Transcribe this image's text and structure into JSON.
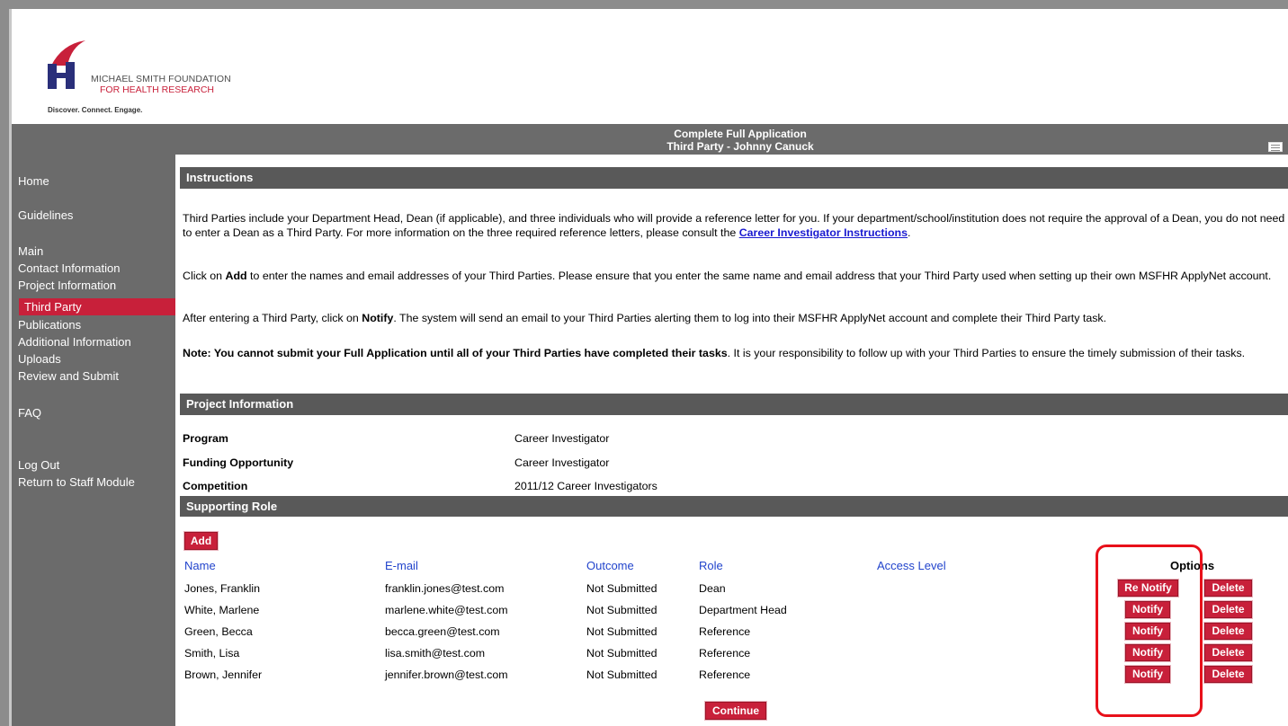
{
  "logo": {
    "line1": "MICHAEL SMITH FOUNDATION",
    "line2": "FOR HEALTH RESEARCH",
    "tagline": "Discover. Connect. Engage."
  },
  "header": {
    "title": "Complete Full Application",
    "subtitle": "Third Party  -  Johnny Canuck"
  },
  "sidebar": {
    "items": [
      {
        "label": "Home"
      },
      {
        "label": "Guidelines"
      },
      {
        "label": "Main"
      },
      {
        "label": "Contact Information"
      },
      {
        "label": "Project Information"
      },
      {
        "label": "Third Party"
      },
      {
        "label": "Publications"
      },
      {
        "label": "Additional Information"
      },
      {
        "label": "Uploads"
      },
      {
        "label": "Review and Submit"
      },
      {
        "label": "FAQ"
      },
      {
        "label": "Log Out"
      },
      {
        "label": "Return to Staff Module"
      }
    ]
  },
  "instructions": {
    "heading": "Instructions",
    "p1_text": "Third Parties include your Department Head, Dean (if applicable), and three individuals who will provide a reference letter for you. If your department/school/institution does not require the approval of a Dean, you do not need to enter a Dean as a Third Party. For more information on the three required reference letters, please consult the ",
    "p1_link": "Career Investigator Instructions",
    "p1_end": ".",
    "p2_pre": "Click on ",
    "p2_bold": "Add",
    "p2_post": " to enter the names and email addresses of your Third Parties. Please ensure that you enter the same name and email address that your Third Party used when setting up their own MSFHR ApplyNet account.",
    "p3_pre": "After entering a Third Party, click on ",
    "p3_bold": "Notify",
    "p3_post": ". The system will send an email to your Third Parties alerting them to log into their MSFHR ApplyNet account and complete their Third Party task.",
    "p4_bold": "Note: You cannot submit your Full Application until all of your Third Parties have completed their tasks",
    "p4_post": ". It is your responsibility to follow up with your Third Parties to ensure the timely submission of their tasks."
  },
  "project": {
    "heading": "Project Information",
    "fields": [
      {
        "label": "Program",
        "value": "Career Investigator"
      },
      {
        "label": "Funding Opportunity",
        "value": "Career Investigator"
      },
      {
        "label": "Competition",
        "value": "2011/12 Career Investigators"
      }
    ]
  },
  "supporting": {
    "heading": "Supporting Role",
    "add_label": "Add",
    "columns": {
      "name": "Name",
      "email": "E-mail",
      "outcome": "Outcome",
      "role": "Role",
      "access": "Access Level",
      "options": "Options"
    },
    "rows": [
      {
        "name": "Jones, Franklin",
        "email": "franklin.jones@test.com",
        "outcome": "Not Submitted",
        "role": "Dean",
        "notify": "Re Notify",
        "delete": "Delete"
      },
      {
        "name": "White, Marlene",
        "email": "marlene.white@test.com",
        "outcome": "Not Submitted",
        "role": "Department Head",
        "notify": "Notify",
        "delete": "Delete"
      },
      {
        "name": "Green, Becca",
        "email": "becca.green@test.com",
        "outcome": "Not Submitted",
        "role": "Reference",
        "notify": "Notify",
        "delete": "Delete"
      },
      {
        "name": "Smith, Lisa",
        "email": "lisa.smith@test.com",
        "outcome": "Not Submitted",
        "role": "Reference",
        "notify": "Notify",
        "delete": "Delete"
      },
      {
        "name": "Brown, Jennifer",
        "email": "jennifer.brown@test.com",
        "outcome": "Not Submitted",
        "role": "Reference",
        "notify": "Notify",
        "delete": "Delete"
      }
    ],
    "continue_label": "Continue"
  },
  "colors": {
    "brand_red": "#c8203a",
    "nav_gray": "#6b6b6b",
    "section_bar": "#595959",
    "link_blue": "#2244cc",
    "highlight": "#e8101a"
  },
  "icons": {
    "logo": "msfhr-logo-icon",
    "print": "print-icon"
  }
}
